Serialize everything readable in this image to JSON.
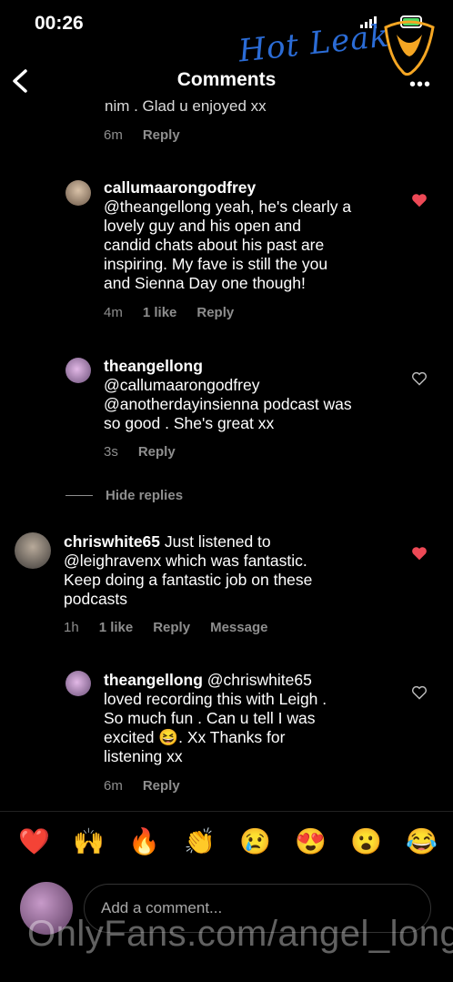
{
  "status_bar": {
    "time": "00:26"
  },
  "watermark": {
    "top_text": "Hot Leak",
    "bottom_text": "OnlyFans.com/angel_long"
  },
  "header": {
    "title": "Comments"
  },
  "prev_comment": {
    "partial_text": "nim . Glad u enjoyed xx",
    "time": "6m",
    "reply": "Reply"
  },
  "comments": [
    {
      "user": "callumaarongodfrey",
      "lines": [
        "@theangellong yeah, he's clearly a",
        "lovely guy and his open and",
        "candid chats about his past are",
        "inspiring. My fave is still the you",
        "and Sienna Day one though!"
      ],
      "time": "4m",
      "likes": "1 like",
      "reply": "Reply",
      "liked": true
    },
    {
      "user": "theangellong",
      "lines": [
        "@callumaarongodfrey",
        "@anotherdayinsienna podcast was",
        "so good . She's great xx"
      ],
      "time": "3s",
      "reply": "Reply",
      "liked": false
    },
    {
      "user": "chriswhite65",
      "lines": [
        "Just listened to",
        "@leighravenx which was fantastic.",
        "Keep doing a fantastic job on these",
        "podcasts"
      ],
      "time": "1h",
      "likes": "1 like",
      "reply": "Reply",
      "message": "Message",
      "liked": true
    },
    {
      "user": "theangellong",
      "lines": [
        "@chriswhite65",
        "loved recording this with Leigh .",
        "So much fun . Can u tell I was",
        "excited 😆. Xx Thanks for",
        "listening xx"
      ],
      "time": "6m",
      "reply": "Reply",
      "liked": false
    }
  ],
  "hide_replies": "Hide replies",
  "emoji_bar": [
    "❤️",
    "🙌",
    "🔥",
    "👏",
    "😢",
    "😍",
    "😮",
    "😂"
  ],
  "composer": {
    "placeholder": "Add a comment..."
  },
  "colors": {
    "background": "#000000",
    "secondary_text": "#8e8e8e",
    "like_red": "#ed4956",
    "watermark_blue": "#2b6cd6"
  }
}
